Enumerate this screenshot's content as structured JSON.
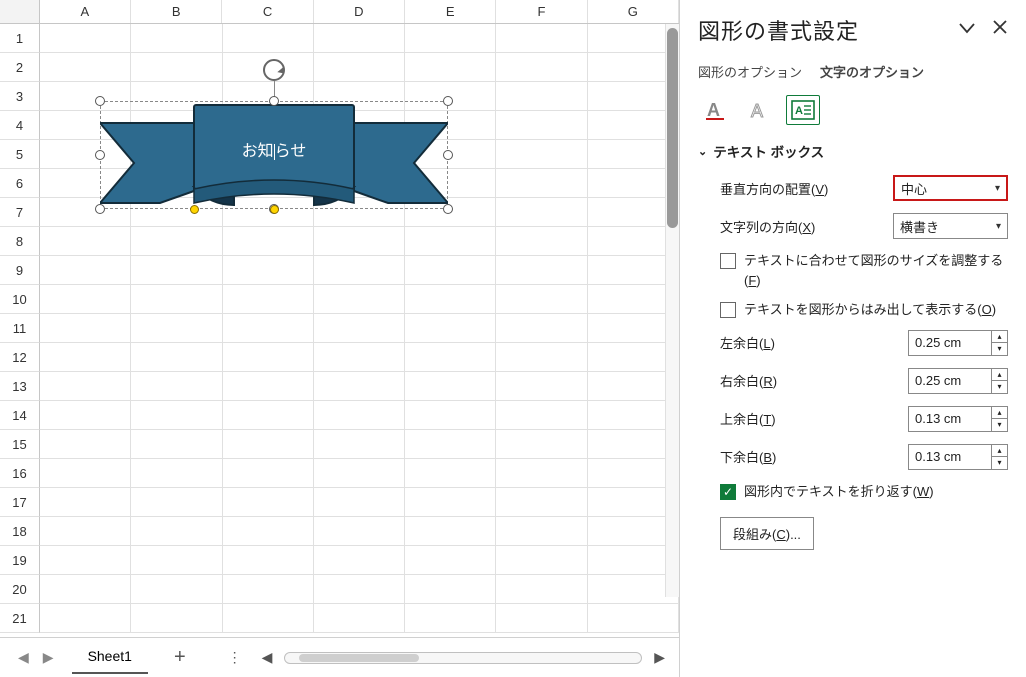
{
  "columns": [
    "A",
    "B",
    "C",
    "D",
    "E",
    "F",
    "G"
  ],
  "rows_count": 21,
  "shape_text": "お知らせ",
  "sheet_tab": "Sheet1",
  "pane": {
    "title": "図形の書式設定",
    "opt_tabs": {
      "shape": "図形のオプション",
      "text": "文字のオプション"
    },
    "section": "テキスト ボックス",
    "valign_label_pre": "垂直方向の配置(",
    "valign_label_u": "V",
    "valign_label_post": ")",
    "valign_value": "中心",
    "dir_label_pre": "文字列の方向(",
    "dir_label_u": "X",
    "dir_label_post": ")",
    "dir_value": "横書き",
    "autofit_pre": "テキストに合わせて図形のサイズを調整する(",
    "autofit_u": "F",
    "autofit_post": ")",
    "overflow_pre": "テキストを図形からはみ出して表示する(",
    "overflow_u": "O",
    "overflow_post": ")",
    "lm_label_pre": "左余白(",
    "lm_u": "L",
    "lm_post": ")",
    "lm_val": "0.25 cm",
    "rm_label_pre": "右余白(",
    "rm_u": "R",
    "rm_post": ")",
    "rm_val": "0.25 cm",
    "tm_label_pre": "上余白(",
    "tm_u": "T",
    "tm_post": ")",
    "tm_val": "0.13 cm",
    "bm_label_pre": "下余白(",
    "bm_u": "B",
    "bm_post": ")",
    "bm_val": "0.13 cm",
    "wrap_pre": "図形内でテキストを折り返す(",
    "wrap_u": "W",
    "wrap_post": ")",
    "columns_btn_pre": "段組み(",
    "columns_btn_u": "C",
    "columns_btn_post": ")..."
  }
}
